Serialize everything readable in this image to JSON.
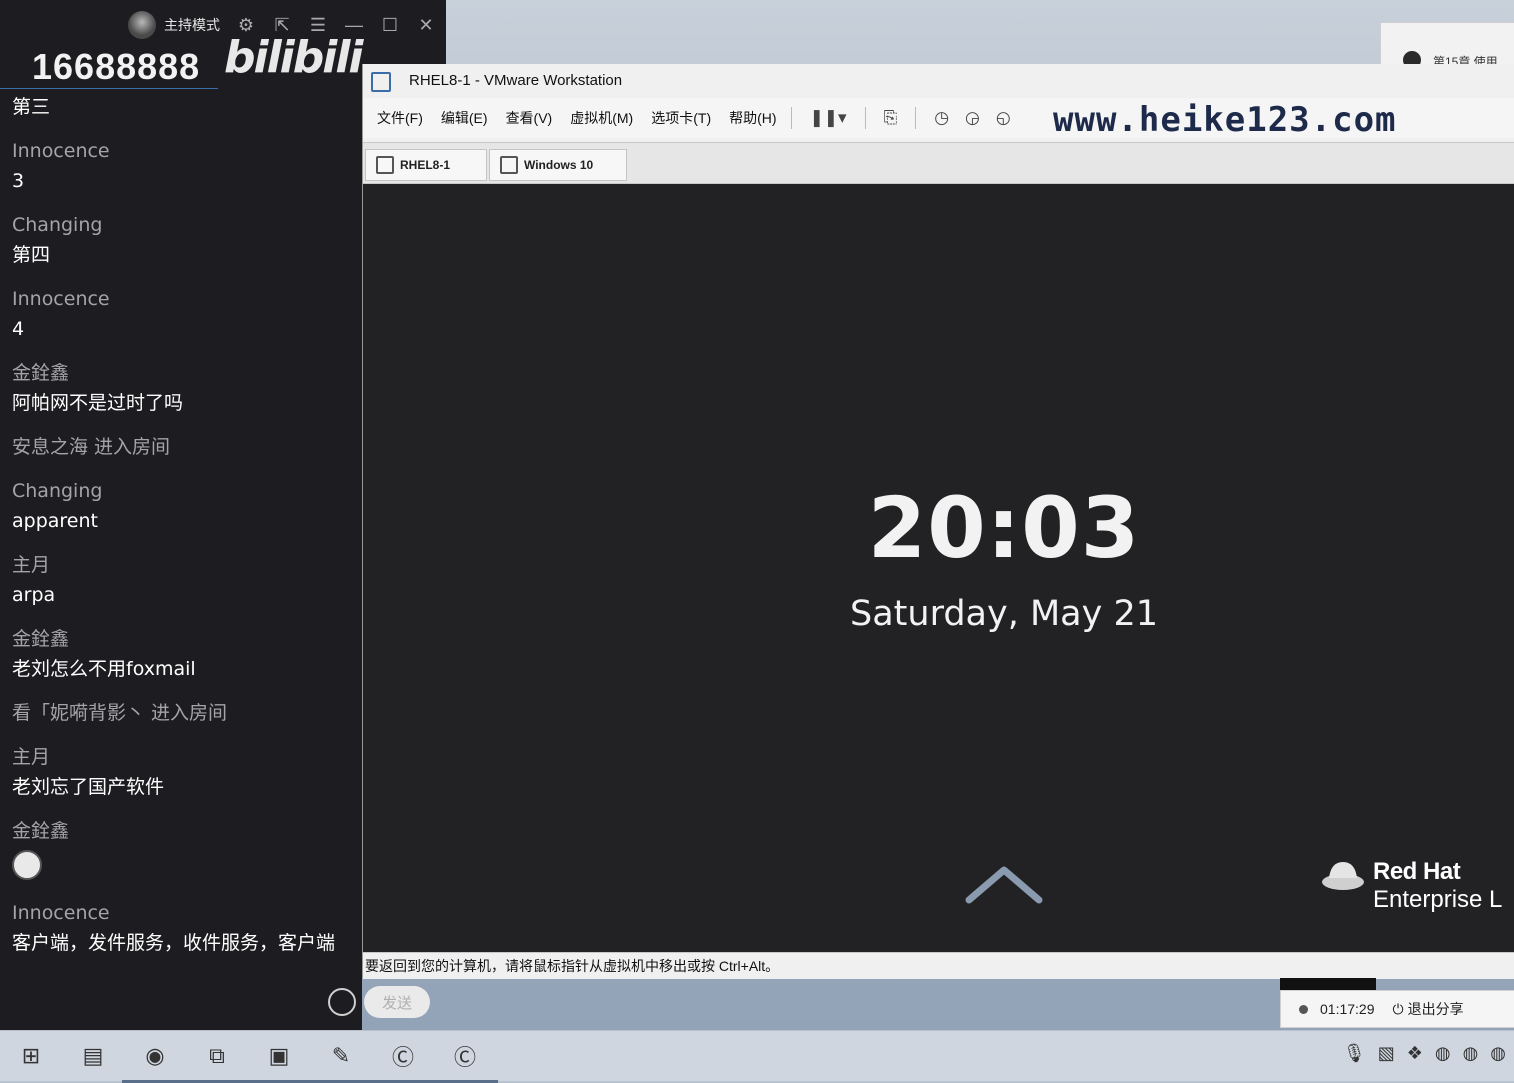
{
  "chat": {
    "host_mode_label": "主持模式",
    "room_id": "16688888",
    "logo_text": "bilibili",
    "messages": [
      {
        "type": "text",
        "text": "第三"
      },
      {
        "type": "msg",
        "user": "Innocence",
        "text": "3"
      },
      {
        "type": "msg",
        "user": "Changing",
        "text": "第四"
      },
      {
        "type": "msg",
        "user": "Innocence",
        "text": "4"
      },
      {
        "type": "msg",
        "user": "金銓鑫",
        "text": "阿帕网不是过时了吗"
      },
      {
        "type": "sys",
        "text": "安息之海 进入房间"
      },
      {
        "type": "msg",
        "user": "Changing",
        "text": "apparent"
      },
      {
        "type": "msg",
        "user": "主月",
        "text": "arpa"
      },
      {
        "type": "msg",
        "user": "金銓鑫",
        "text": "老刘怎么不用foxmail"
      },
      {
        "type": "sys",
        "text": "看「妮嗬背影丶 进入房间"
      },
      {
        "type": "msg",
        "user": "主月",
        "text": "老刘忘了国产软件"
      },
      {
        "type": "emoji",
        "user": "金銓鑫"
      },
      {
        "type": "msg",
        "user": "Innocence",
        "text": "客户端，发件服务，收件服务，客户端"
      }
    ],
    "send_label": "发送"
  },
  "vm": {
    "title": "RHEL8-1 - VMware Workstation",
    "menu": [
      "文件(F)",
      "编辑(E)",
      "查看(V)",
      "虚拟机(M)",
      "选项卡(T)",
      "帮助(H)"
    ],
    "watermark": "www.heike123.com",
    "tabs": [
      "RHEL8-1",
      "Windows 10"
    ],
    "clock": "20:03",
    "date": "Saturday, May 21",
    "brand_name": "Red Hat",
    "brand_product": "Enterprise L",
    "status": "要返回到您的计算机，请将鼠标指针从虚拟机中移出或按 Ctrl+Alt。"
  },
  "share": {
    "time": "01:17:29",
    "exit_label": "退出分享"
  },
  "desktop": {
    "peek_text": "第15章 使用"
  },
  "colors": {
    "chat_bg": "#1d1d21",
    "vm_screen_bg": "#222224",
    "taskbar_bg": "#cfd6df"
  }
}
